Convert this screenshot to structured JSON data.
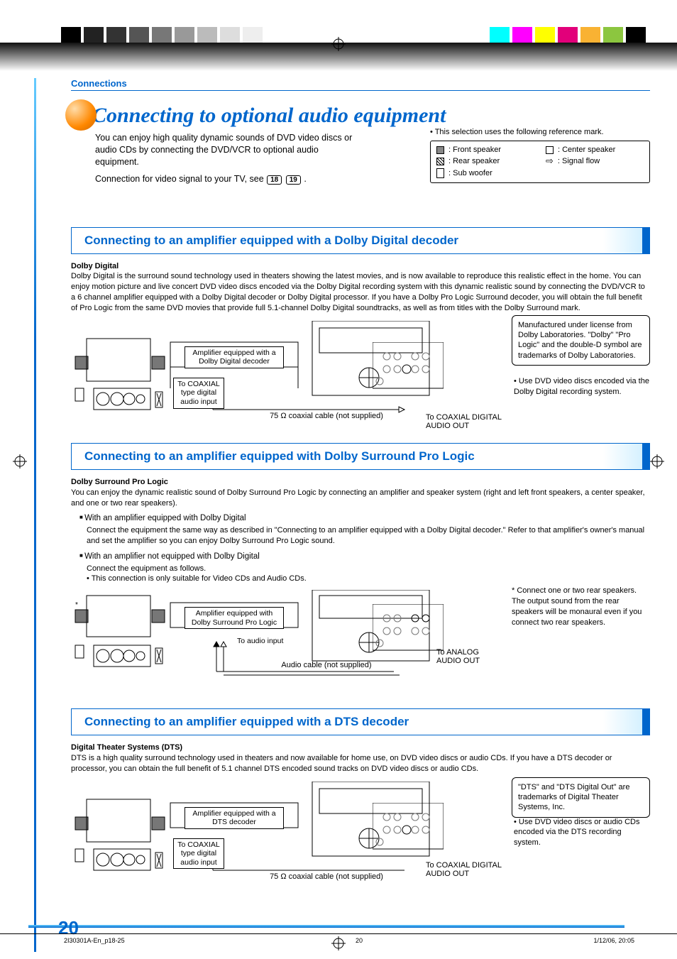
{
  "breadcrumb": "Connections",
  "page_title": "Connecting to optional audio equipment",
  "intro_para": "You can enjoy high quality dynamic sounds of DVD video discs or audio CDs by connecting the DVD/VCR to optional audio equipment.",
  "intro_line2_a": "Connection for video signal to your TV, see ",
  "intro_line2_b": ".",
  "pgref_18": "18",
  "pgref_19": "19",
  "ref_intro": "• This selection uses the following reference mark.",
  "legend": {
    "front": ": Front speaker",
    "rear": ": Rear speaker",
    "sub": ": Sub woofer",
    "center": ": Center speaker",
    "flow": ": Signal flow"
  },
  "sections": {
    "dolby_digital": {
      "title": "Connecting to an amplifier equipped with a Dolby Digital decoder",
      "sub_head": "Dolby Digital",
      "body": "Dolby Digital is the surround sound technology used in theaters showing the latest movies, and is now available to reproduce this realistic effect in the home. You can enjoy motion picture and live concert DVD video discs encoded via the Dolby Digital recording system with this dynamic realistic sound by connecting the DVD/VCR to a 6 channel amplifier equipped with a Dolby Digital decoder or Dolby Digital processor. If you have a Dolby Pro Logic Surround decoder, you will obtain the full benefit of Pro Logic from the same DVD movies that provide full 5.1-channel Dolby Digital soundtracks, as well as from titles with the Dolby Surround mark.",
      "note": "Manufactured under license from Dolby Laboratories. \"Dolby\" \"Pro Logic\" and the double-D symbol are trademarks of Dolby Laboratories.",
      "tip": "Use DVD video discs encoded via the Dolby Digital recording system.",
      "amp_label": "Amplifier equipped with a\nDolby Digital decoder",
      "to_coax_label": "To COAXIAL\ntype digital\naudio input",
      "cable_label": "75 Ω coaxial cable (not supplied)",
      "out_label": "To COAXIAL DIGITAL\nAUDIO OUT"
    },
    "pro_logic": {
      "title": "Connecting to an amplifier equipped with Dolby Surround Pro Logic",
      "sub_head": "Dolby Surround Pro Logic",
      "body": "You can enjoy the dynamic realistic sound of Dolby Surround Pro Logic by connecting an amplifier and speaker system (right and left front speakers, a center speaker, and one or two rear speakers).",
      "b1": "With an amplifier equipped with Dolby Digital",
      "b1_text": "Connect the equipment the same way as described in \"Connecting to an amplifier equipped with a Dolby Digital decoder.\" Refer to that amplifier's owner's manual and set the amplifier so you can enjoy Dolby Surround Pro Logic sound.",
      "b2": "With an amplifier not equipped with Dolby Digital",
      "b2_text": "Connect the equipment as follows.",
      "b2_sub": "• This connection is only suitable for Video CDs and Audio CDs.",
      "amp_label": "Amplifier equipped with\nDolby Surround Pro Logic",
      "to_audio_label": "To audio input",
      "cable_label": "Audio cable (not supplied)",
      "out_label": "To ANALOG\nAUDIO OUT",
      "aside": "* Connect one or two rear speakers. The output sound from the rear speakers will be monaural even if you connect two rear speakers."
    },
    "dts": {
      "title": "Connecting to an amplifier equipped with a DTS decoder",
      "sub_head": "Digital Theater Systems (DTS)",
      "body": "DTS is a high quality surround technology used in theaters and now available for home use, on DVD video discs or audio CDs. If you have a DTS decoder or processor, you can obtain the full benefit of 5.1 channel DTS encoded sound tracks on DVD video discs or audio CDs.",
      "note": "\"DTS\" and \"DTS Digital Out\" are trademarks of Digital Theater Systems, Inc.",
      "tip": "Use DVD video discs or audio CDs encoded via the DTS recording system.",
      "amp_label": "Amplifier equipped with a\nDTS decoder",
      "to_coax_label": "To COAXIAL\ntype digital\naudio input",
      "cable_label": "75 Ω coaxial cable (not supplied)",
      "out_label": "To COAXIAL DIGITAL\nAUDIO OUT"
    }
  },
  "page_number": "20",
  "footer": {
    "file": "2I30301A-En_p18-25",
    "page": "20",
    "date": "1/12/06, 20:05"
  }
}
